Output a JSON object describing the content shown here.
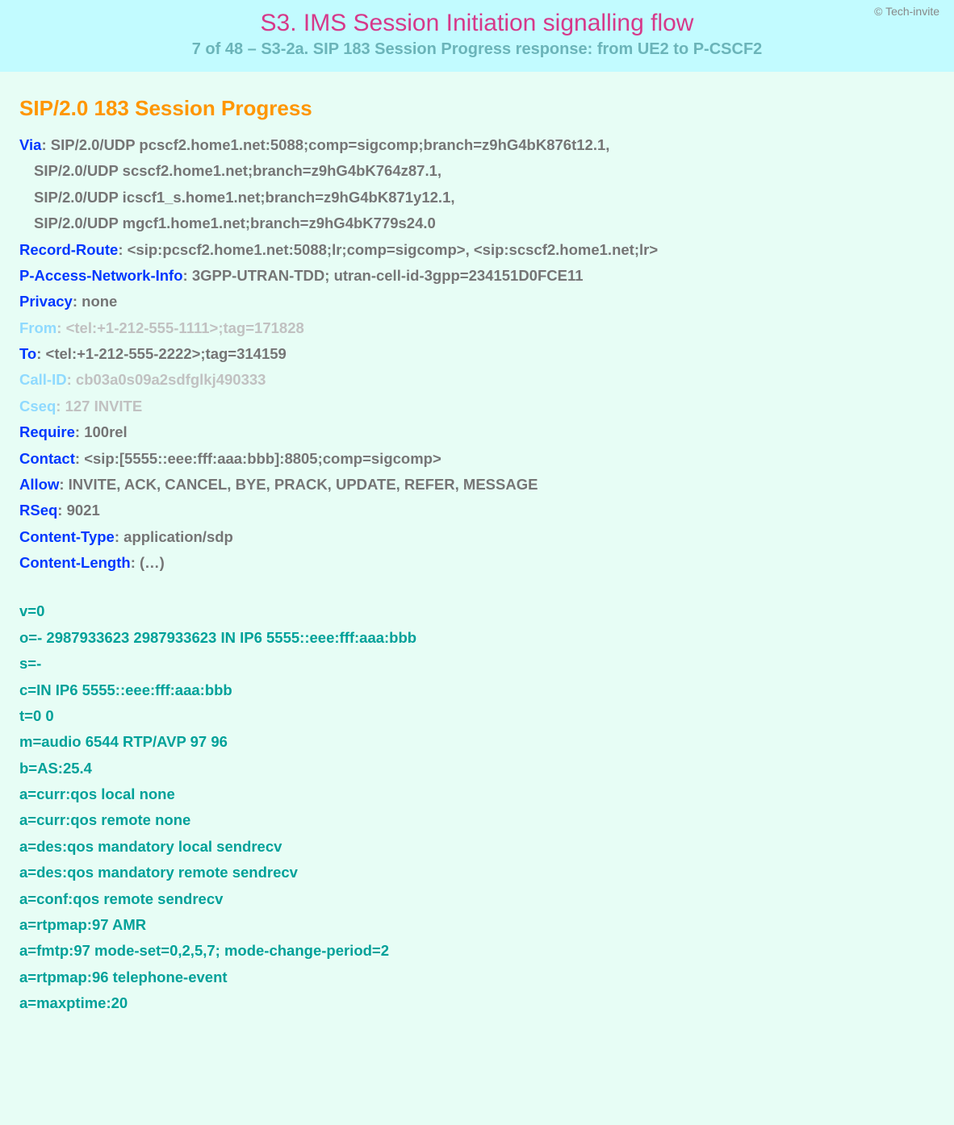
{
  "copyright": "© Tech-invite",
  "title": "S3. IMS Session Initiation signalling flow",
  "subtitle": "7 of 48 – S3-2a. SIP 183 Session Progress response: from UE2 to P-CSCF2",
  "status": "SIP/2.0 183 Session Progress",
  "headers": [
    {
      "name": "Via",
      "style": "blue",
      "value": "SIP/2.0/UDP pcscf2.home1.net:5088;comp=sigcomp;branch=z9hG4bK876t12.1,",
      "vstyle": "gray"
    },
    {
      "cont": true,
      "value": "SIP/2.0/UDP scscf2.home1.net;branch=z9hG4bK764z87.1,",
      "vstyle": "gray"
    },
    {
      "cont": true,
      "value": "SIP/2.0/UDP icscf1_s.home1.net;branch=z9hG4bK871y12.1,",
      "vstyle": "gray"
    },
    {
      "cont": true,
      "value": "SIP/2.0/UDP mgcf1.home1.net;branch=z9hG4bK779s24.0",
      "vstyle": "gray"
    },
    {
      "name": "Record-Route",
      "style": "blue",
      "value": "<sip:pcscf2.home1.net:5088;lr;comp=sigcomp>, <sip:scscf2.home1.net;lr>",
      "vstyle": "gray"
    },
    {
      "name": "P-Access-Network-Info",
      "style": "blue",
      "value": "3GPP-UTRAN-TDD; utran-cell-id-3gpp=234151D0FCE11",
      "vstyle": "gray"
    },
    {
      "name": "Privacy",
      "style": "blue",
      "value": "none",
      "vstyle": "gray"
    },
    {
      "name": "From",
      "style": "light",
      "value": "<tel:+1-212-555-1111>;tag=171828",
      "vstyle": "light"
    },
    {
      "name": "To",
      "style": "blue",
      "value": "<tel:+1-212-555-2222>;tag=314159",
      "vstyle": "gray"
    },
    {
      "name": "Call-ID",
      "style": "light",
      "value": "cb03a0s09a2sdfglkj490333",
      "vstyle": "light"
    },
    {
      "name": "Cseq",
      "style": "light",
      "value": "127 INVITE",
      "vstyle": "light"
    },
    {
      "name": "Require",
      "style": "blue",
      "value": "100rel",
      "vstyle": "gray"
    },
    {
      "name": "Contact",
      "style": "blue",
      "value": "<sip:[5555::eee:fff:aaa:bbb]:8805;comp=sigcomp>",
      "vstyle": "gray"
    },
    {
      "name": "Allow",
      "style": "blue",
      "value": "INVITE, ACK, CANCEL, BYE, PRACK, UPDATE, REFER, MESSAGE",
      "vstyle": "gray"
    },
    {
      "name": "RSeq",
      "style": "blue",
      "value": "9021",
      "vstyle": "gray"
    },
    {
      "name": "Content-Type",
      "style": "blue",
      "value": "application/sdp",
      "vstyle": "gray"
    },
    {
      "name": "Content-Length",
      "style": "blue",
      "value": "(…)",
      "vstyle": "gray"
    }
  ],
  "sdp": [
    "v=0",
    "o=- 2987933623 2987933623 IN IP6 5555::eee:fff:aaa:bbb",
    "s=-",
    "c=IN IP6 5555::eee:fff:aaa:bbb",
    "t=0 0",
    "m=audio 6544 RTP/AVP 97 96",
    "b=AS:25.4",
    "a=curr:qos local none",
    "a=curr:qos remote none",
    "a=des:qos mandatory local sendrecv",
    "a=des:qos mandatory remote sendrecv",
    "a=conf:qos remote sendrecv",
    "a=rtpmap:97 AMR",
    "a=fmtp:97 mode-set=0,2,5,7; mode-change-period=2",
    "a=rtpmap:96 telephone-event",
    "a=maxptime:20"
  ]
}
